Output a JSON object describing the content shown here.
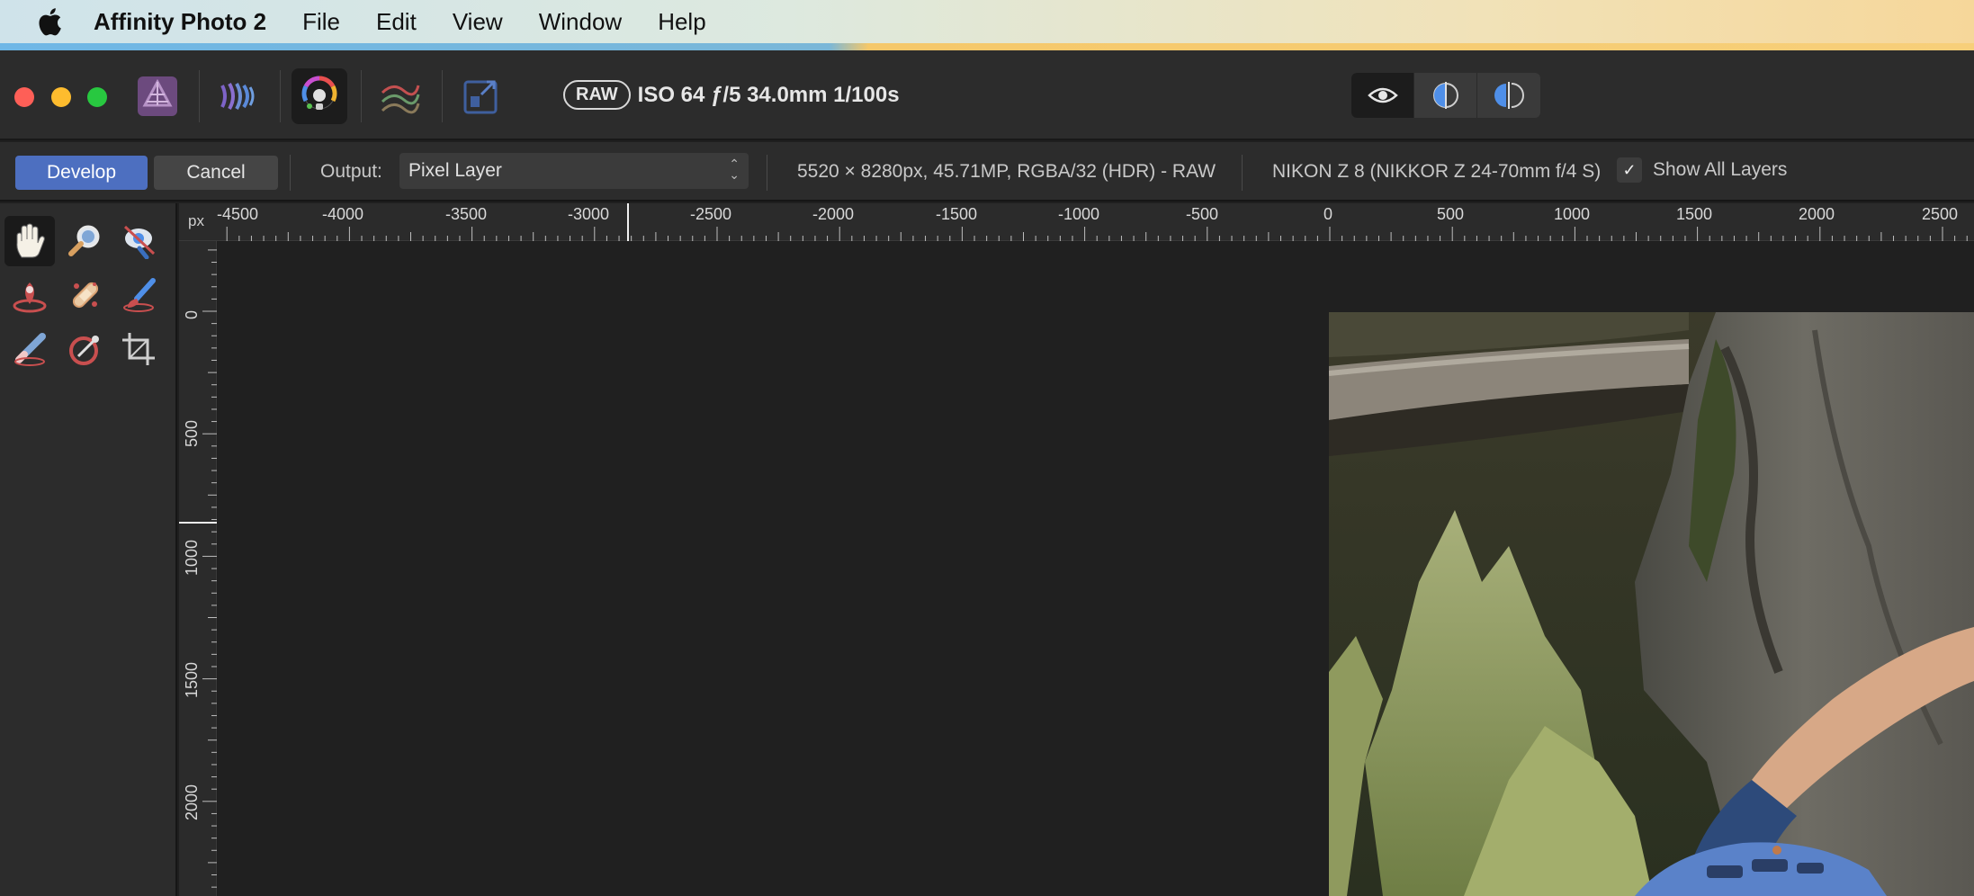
{
  "menubar": {
    "app_name": "Affinity Photo 2",
    "menus": [
      "File",
      "Edit",
      "View",
      "Window",
      "Help"
    ]
  },
  "toolbar": {
    "personas": [
      "photo-persona-icon",
      "liquify-persona-icon",
      "develop-persona-icon",
      "tone-mapping-persona-icon",
      "export-persona-icon"
    ],
    "active_persona": "develop-persona-icon",
    "exif": {
      "raw_badge": "RAW",
      "summary": "ISO 64 ƒ/5 34.0mm 1/100s"
    },
    "view_modes": [
      "eye-icon",
      "split-view-icon",
      "mirror-view-icon"
    ]
  },
  "contextbar": {
    "develop_label": "Develop",
    "cancel_label": "Cancel",
    "output_label": "Output:",
    "output_value": "Pixel Layer",
    "doc_info": "5520 × 8280px, 45.71MP, RGBA/32 (HDR) - RAW",
    "camera_info": "NIKON Z 8 (NIKKOR Z 24-70mm f/4 S)",
    "show_all_layers_label": "Show All Layers",
    "show_all_layers_checked": true
  },
  "tools": [
    "hand-tool-icon",
    "zoom-tool-icon",
    "red-eye-tool-icon",
    "overlay-gradient-icon",
    "blemish-removal-icon",
    "overlay-brush-icon",
    "overlay-erase-icon",
    "white-balance-picker-icon",
    "crop-tool-icon"
  ],
  "ruler": {
    "unit": "px",
    "horizontal_labels": [
      "-4500",
      "-4000",
      "-3500",
      "-3000",
      "-2500",
      "-2000",
      "-1500",
      "-1000",
      "-500",
      "0",
      "500",
      "1000",
      "1500",
      "2000",
      "2500"
    ],
    "vertical_labels": [
      "0",
      "500",
      "1000",
      "1500",
      "2000"
    ]
  },
  "colors": {
    "accent": "#4d6fc0",
    "panel": "#2c2c2c",
    "canvas": "#202020"
  }
}
